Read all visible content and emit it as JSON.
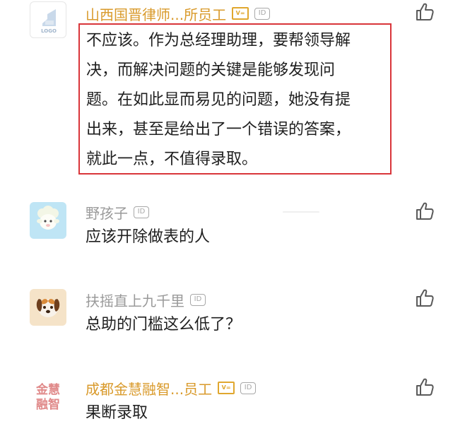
{
  "comments": [
    {
      "name": "山西国晋律师...所员工",
      "id_badge": "ID",
      "avatar_text": "LOGO",
      "text_lines": [
        "不应该。作为总经理助理，要帮领导解",
        "决，而解决问题的关键是能够发现问",
        "题。在如此显而易见的问题，她没有提",
        "出来，甚至是给出了一个错误的答案，",
        "就此一点，不值得录取。"
      ]
    },
    {
      "name": "野孩子",
      "id_badge": "ID",
      "text": "应该开除做表的人"
    },
    {
      "name": "扶摇直上九千里",
      "id_badge": "ID",
      "text": "总助的门槛这么低了？"
    },
    {
      "name": "成都金慧融智...员工",
      "id_badge": "ID",
      "avatar_text_1": "金慧",
      "avatar_text_2": "融智",
      "text": "果断录取"
    }
  ],
  "colors": {
    "verified_name": "#d99a2b",
    "regular_name": "#9a9a9a",
    "highlight_border": "#d9353a",
    "like_icon": "#5a5a5a"
  }
}
